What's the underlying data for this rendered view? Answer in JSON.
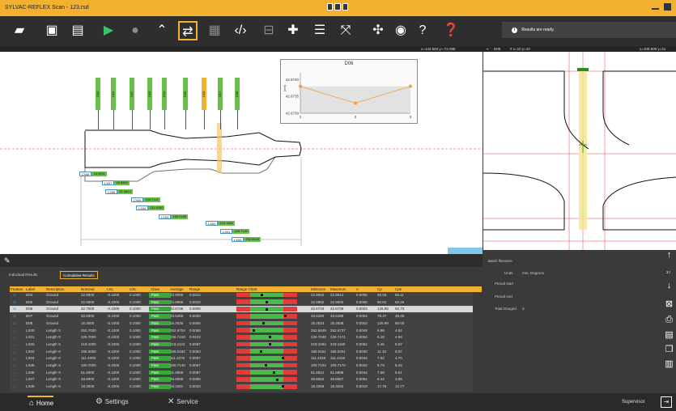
{
  "window": {
    "title": "SYLVAC-REFLEX Scan - 123.rsd"
  },
  "status": {
    "message": "Results are ready."
  },
  "coords": {
    "left": "x=143.594 y=-72.095",
    "right_label": "D06",
    "right_pos": "# x=10 y=10",
    "right_coords": "x=105.809 y=21"
  },
  "features_top": [
    "D00",
    "D01",
    "D02",
    "D03",
    "D04",
    "D05",
    "D06",
    "D07",
    "D08"
  ],
  "inset_chart": {
    "title": "D06",
    "yticks": [
      "42.6740",
      "42.6735",
      "42.6730"
    ],
    "xticks": [
      "1",
      "2",
      "3"
    ],
    "ylabel": "[mm]"
  },
  "chart_data": {
    "type": "line",
    "title": "D06",
    "x": [
      1,
      2,
      3
    ],
    "values": [
      42.6738,
      42.6733,
      42.6738
    ],
    "ylim": [
      42.673,
      42.6742
    ],
    "ylabel": "[mm]"
  },
  "dimensions": [
    {
      "name": "LX08",
      "value": "18.3292"
    },
    {
      "name": "LX07",
      "value": "48.8562"
    },
    {
      "name": "LX06",
      "value": "51.6812"
    },
    {
      "name": "LX05",
      "value": "100.7147"
    },
    {
      "name": "LX04",
      "value": "111.4180"
    },
    {
      "name": "LX03",
      "value": "155.0199"
    },
    {
      "name": "LX02",
      "value": "219.1160"
    },
    {
      "name": "LX01",
      "value": "226.7142"
    },
    {
      "name": "LX00",
      "value": "252.6649"
    }
  ],
  "tabs": {
    "individual": "Individual Results",
    "cumulative": "Cumulative Results"
  },
  "table": {
    "headers": [
      "Feature",
      "Label",
      "Description",
      "Nominal",
      "LSL",
      "USL",
      "Class",
      "Average",
      "Range",
      "Range Chart",
      "Minimum",
      "Maximum",
      "σ",
      "Cp",
      "Cpk"
    ],
    "rows": [
      [
        "D04",
        "Ground",
        "22.9000",
        "-0.1000",
        "0.1000",
        "Pass",
        "22.9008",
        "0.0012",
        "22.9002",
        "22.9014",
        "0.0005",
        "55.56",
        "55.11"
      ],
      [
        "D05",
        "Ground",
        "22.9000",
        "-0.1000",
        "0.1000",
        "Pass",
        "22.8996",
        "0.0010",
        "22.8992",
        "22.9002",
        "0.0006",
        "60.52",
        "60.26"
      ],
      [
        "D06",
        "Ground",
        "42.7000",
        "-0.1000",
        "0.1000",
        "Pass",
        "42.6736",
        "0.0005",
        "42.6733",
        "42.6738",
        "0.0003",
        "125.99",
        "92.73"
      ],
      [
        "D07",
        "Ground",
        "33.5000",
        "-0.1000",
        "0.1000",
        "Pass",
        "33.5485",
        "0.0004",
        "33.5480",
        "33.5488",
        "0.0004",
        "76.47",
        "39.36"
      ],
      [
        "D08",
        "Ground",
        "15.3000",
        "-0.1000",
        "0.1000",
        "Pass",
        "15.2635",
        "0.0005",
        "15.2633",
        "15.2638",
        "0.0003",
        "125.99",
        "80.00"
      ],
      [
        "LX00",
        "Length X",
        "252.7000",
        "-0.1000",
        "0.1000",
        "Pass",
        "252.6704",
        "0.0088",
        "252.6649",
        "252.6737",
        "0.0048",
        "6.98",
        "4.92"
      ],
      [
        "LX01",
        "Length X",
        "226.7000",
        "-0.1000",
        "0.1000",
        "Pass",
        "226.7120",
        "0.0123",
        "226.7048",
        "226.7171",
        "0.0064",
        "5.18",
        "4.56"
      ],
      [
        "LX02",
        "Length X",
        "219.1000",
        "-0.1000",
        "0.1000",
        "Pass",
        "219.1122",
        "0.0097",
        "219.1063",
        "219.1160",
        "0.0052",
        "6.46",
        "5.67"
      ],
      [
        "LX03",
        "Length X",
        "155.0000",
        "-0.1000",
        "0.1000",
        "Pass",
        "155.0183",
        "0.0053",
        "155.0161",
        "155.0201",
        "0.0030",
        "11.10",
        "9.07"
      ],
      [
        "LX04",
        "Length X",
        "111.4000",
        "-0.1000",
        "0.1000",
        "Pass",
        "111.4376",
        "0.0087",
        "111.4328",
        "111.4415",
        "0.0044",
        "7.52",
        "4.70"
      ],
      [
        "LX05",
        "Length X",
        "100.7000",
        "-0.1000",
        "0.1000",
        "Pass",
        "100.7140",
        "0.0067",
        "100.7103",
        "100.7170",
        "0.0034",
        "9.79",
        "8.42"
      ],
      [
        "LX06",
        "Length X",
        "51.6000",
        "-0.1000",
        "0.1000",
        "Pass",
        "51.6859",
        "0.0087",
        "51.6812",
        "51.6899",
        "0.0044",
        "7.58",
        "6.51"
      ],
      [
        "LX07",
        "Length X",
        "48.9000",
        "-0.1000",
        "0.1000",
        "Pass",
        "48.8598",
        "0.0095",
        "48.8562",
        "48.8657",
        "0.0052",
        "6.44",
        "3.85"
      ],
      [
        "LX08",
        "Length X",
        "18.3000",
        "-0.1000",
        "0.1000",
        "Pass",
        "18.3281",
        "0.0033",
        "18.3259",
        "18.3292",
        "0.0019",
        "17.76",
        "12.77"
      ]
    ],
    "markers": [
      0.42,
      0.5,
      0.5,
      0.82,
      0.45,
      0.28,
      0.55,
      0.55,
      0.4,
      0.78,
      0.48,
      0.62,
      0.68,
      0.78
    ]
  },
  "summary": {
    "batch": "Batch filename",
    "units_label": "Units",
    "units_value": "mm, Degrees",
    "period_start": "Period start",
    "period_end": "Period end",
    "total_label": "Total Gauged",
    "total_value": "3",
    "page": "3 /"
  },
  "bottom": {
    "home": "Home",
    "settings": "Settings",
    "service": "Service",
    "user": "Supervisor"
  }
}
